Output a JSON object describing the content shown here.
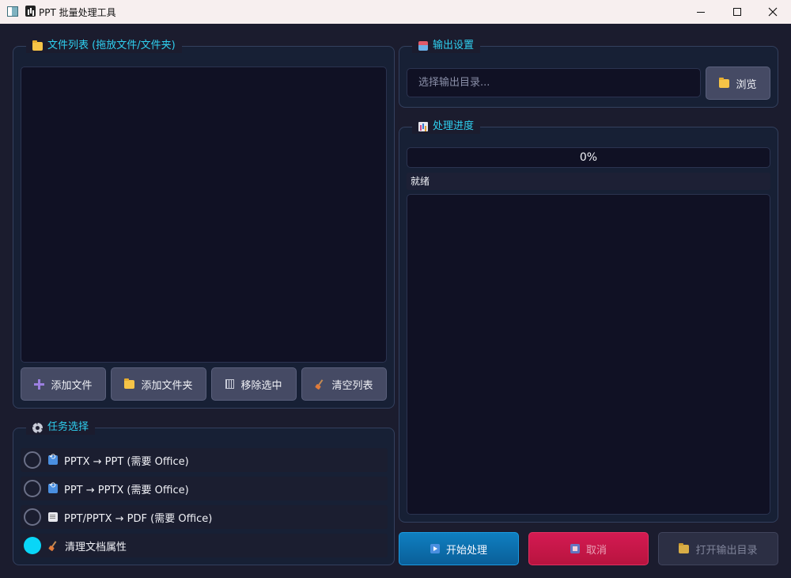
{
  "window": {
    "title": "PPT 批量处理工具",
    "icon": "app-icon",
    "title_icon": "bar-chart-icon"
  },
  "file_list": {
    "title": "文件列表 (拖放文件/文件夹)",
    "icon": "folder-icon",
    "items": [],
    "buttons": {
      "add_files": "添加文件",
      "add_folder": "添加文件夹",
      "remove_selected": "移除选中",
      "clear_list": "清空列表"
    }
  },
  "tasks": {
    "title": "任务选择",
    "icon": "gear-icon",
    "options": [
      {
        "label": "PPTX → PPT (需要 Office)",
        "icon": "convert-icon",
        "checked": false
      },
      {
        "label": "PPT → PPTX (需要 Office)",
        "icon": "convert-icon",
        "checked": false
      },
      {
        "label": "PPT/PPTX → PDF (需要 Office)",
        "icon": "document-icon",
        "checked": false
      },
      {
        "label": "清理文档属性",
        "icon": "broom-icon",
        "checked": true
      }
    ]
  },
  "output": {
    "title": "输出设置",
    "icon": "outbox-icon",
    "path_value": "",
    "path_placeholder": "选择输出目录...",
    "browse_label": "浏览"
  },
  "progress": {
    "title": "处理进度",
    "icon": "chart-icon",
    "percent": 0,
    "percent_text": "0%",
    "status": "就绪",
    "log": ""
  },
  "actions": {
    "start": "开始处理",
    "cancel": "取消",
    "open_output": "打开输出目录"
  },
  "colors": {
    "accent": "#2fd0f0",
    "background": "#1b1c2e",
    "start": "#0a6fb0",
    "cancel": "#c8174a"
  }
}
